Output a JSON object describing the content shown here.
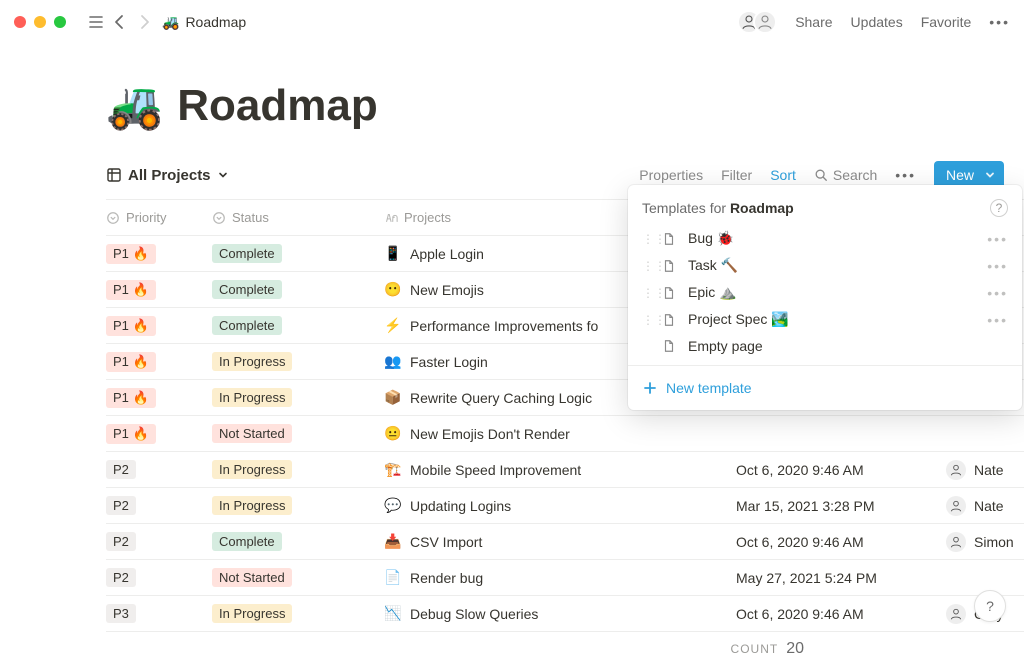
{
  "top": {
    "crumb_emoji": "🚜",
    "crumb_title": "Roadmap",
    "share": "Share",
    "updates": "Updates",
    "favorite": "Favorite"
  },
  "page": {
    "emoji": "🚜",
    "title": "Roadmap"
  },
  "toolbar": {
    "view_label": "All Projects",
    "properties": "Properties",
    "filter": "Filter",
    "sort": "Sort",
    "search": "Search",
    "new": "New"
  },
  "columns": {
    "priority": "Priority",
    "status": "Status",
    "projects": "Projects"
  },
  "rows": [
    {
      "priority": "P1 🔥",
      "pclass": "p1",
      "status": "Complete",
      "sclass": "complete",
      "icon": "📱",
      "name": "Apple Login",
      "date": "",
      "assignee": ""
    },
    {
      "priority": "P1 🔥",
      "pclass": "p1",
      "status": "Complete",
      "sclass": "complete",
      "icon": "😶",
      "name": "New Emojis",
      "date": "",
      "assignee": ""
    },
    {
      "priority": "P1 🔥",
      "pclass": "p1",
      "status": "Complete",
      "sclass": "complete",
      "icon": "⚡",
      "name": "Performance Improvements fo",
      "date": "",
      "assignee": ""
    },
    {
      "priority": "P1 🔥",
      "pclass": "p1",
      "status": "In Progress",
      "sclass": "progress",
      "icon": "👥",
      "name": "Faster Login",
      "date": "",
      "assignee": ""
    },
    {
      "priority": "P1 🔥",
      "pclass": "p1",
      "status": "In Progress",
      "sclass": "progress",
      "icon": "📦",
      "name": "Rewrite Query Caching Logic",
      "date": "",
      "assignee": ""
    },
    {
      "priority": "P1 🔥",
      "pclass": "p1",
      "status": "Not Started",
      "sclass": "notstarted",
      "icon": "😐",
      "name": "New Emojis Don't Render",
      "date": "",
      "assignee": ""
    },
    {
      "priority": "P2",
      "pclass": "p2",
      "status": "In Progress",
      "sclass": "progress",
      "icon": "🏗️",
      "name": "Mobile Speed Improvement",
      "date": "Oct 6, 2020 9:46 AM",
      "assignee": "Nate"
    },
    {
      "priority": "P2",
      "pclass": "p2",
      "status": "In Progress",
      "sclass": "progress",
      "icon": "💬",
      "name": "Updating Logins",
      "date": "Mar 15, 2021 3:28 PM",
      "assignee": "Nate"
    },
    {
      "priority": "P2",
      "pclass": "p2",
      "status": "Complete",
      "sclass": "complete",
      "icon": "📥",
      "name": "CSV Import",
      "date": "Oct 6, 2020 9:46 AM",
      "assignee": "Simon"
    },
    {
      "priority": "P2",
      "pclass": "p2",
      "status": "Not Started",
      "sclass": "notstarted",
      "icon": "📄",
      "name": "Render bug",
      "date": "May 27, 2021 5:24 PM",
      "assignee": ""
    },
    {
      "priority": "P3",
      "pclass": "p3",
      "status": "In Progress",
      "sclass": "progress",
      "icon": "📉",
      "name": "Debug Slow Queries",
      "date": "Oct 6, 2020 9:46 AM",
      "assignee": "Cory"
    }
  ],
  "count": {
    "label": "COUNT",
    "value": "20"
  },
  "popover": {
    "prefix": "Templates for ",
    "bold": "Roadmap",
    "items": [
      {
        "icon": "📄",
        "label": "Bug 🐞",
        "grip": true,
        "dots": true
      },
      {
        "icon": "📄",
        "label": "Task 🔨",
        "grip": true,
        "dots": true
      },
      {
        "icon": "📄",
        "label": "Epic ⛰️",
        "grip": true,
        "dots": true
      },
      {
        "icon": "📄",
        "label": "Project Spec 🏞️",
        "grip": true,
        "dots": true
      },
      {
        "icon": "📄",
        "label": "Empty page",
        "grip": false,
        "dots": false
      }
    ],
    "new_template": "New template"
  }
}
